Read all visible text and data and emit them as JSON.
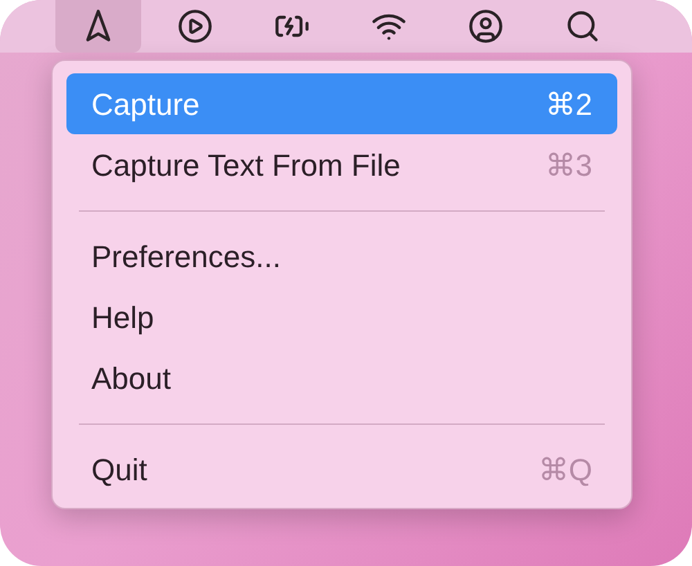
{
  "status_items": [
    {
      "kind": "navigation",
      "selected": true
    },
    {
      "kind": "play",
      "selected": false
    },
    {
      "kind": "battery",
      "selected": false
    },
    {
      "kind": "wifi",
      "selected": false
    },
    {
      "kind": "user",
      "selected": false
    },
    {
      "kind": "search",
      "selected": false
    }
  ],
  "menu": {
    "items": [
      {
        "kind": "item",
        "label": "Capture",
        "shortcut": "⌘2",
        "selected": true
      },
      {
        "kind": "item",
        "label": "Capture Text From File",
        "shortcut": "⌘3",
        "selected": false
      },
      {
        "kind": "separator"
      },
      {
        "kind": "item",
        "label": "Preferences...",
        "selected": false
      },
      {
        "kind": "item",
        "label": "Help",
        "selected": false
      },
      {
        "kind": "item",
        "label": "About",
        "selected": false
      },
      {
        "kind": "separator"
      },
      {
        "kind": "item",
        "label": "Quit",
        "shortcut": "⌘Q",
        "selected": false
      }
    ]
  }
}
